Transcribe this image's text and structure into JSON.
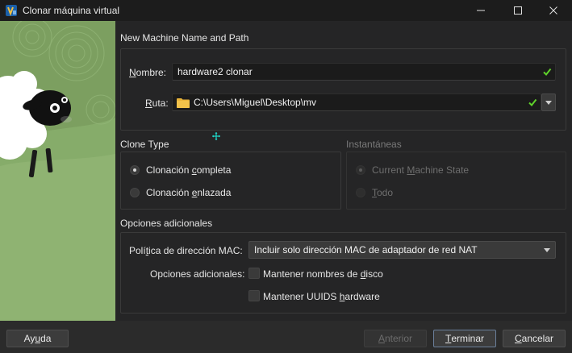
{
  "window": {
    "title": "Clonar máquina virtual",
    "icons": [
      "virtualbox-logo-icon",
      "minimize-icon",
      "maximize-icon",
      "close-icon"
    ]
  },
  "name_path": {
    "header": "New Machine Name and Path",
    "name_label_mnemonic": "N",
    "name_label_rest": "ombre:",
    "name_value": "hardware2 clonar",
    "path_label_mnemonic": "R",
    "path_label_rest": "uta:",
    "path_value": "C:\\Users\\Miguel\\Desktop\\mv"
  },
  "clone_type": {
    "header": "Clone Type",
    "full_pre": "Clonación ",
    "full_mnemonic": "c",
    "full_post": "ompleta",
    "linked_pre": "Clonación ",
    "linked_mnemonic": "e",
    "linked_post": "nlazada",
    "selected": "full"
  },
  "snapshots": {
    "header": "Instantáneas",
    "current_pre": "Current ",
    "current_mnemonic": "M",
    "current_post": "achine State",
    "all_mnemonic": "T",
    "all_post": "odo"
  },
  "additional": {
    "header": "Opciones adicionales",
    "mac_label_pre": "Polí",
    "mac_label_mnemonic": "t",
    "mac_label_post": "ica de dirección MAC:",
    "mac_value": "Incluir solo dirección MAC de adaptador de red NAT",
    "options_label": "Opciones adicionales:",
    "keep_disk_pre": "Mantener nombres de ",
    "keep_disk_mnemonic": "d",
    "keep_disk_post": "isco",
    "keep_uuid_pre": "Mantener UUIDS ",
    "keep_uuid_mnemonic": "h",
    "keep_uuid_post": "ardware"
  },
  "footer": {
    "help_pre": "Ay",
    "help_mnemonic": "u",
    "help_post": "da",
    "back_mnemonic": "A",
    "back_post": "nterior",
    "finish_mnemonic": "T",
    "finish_post": "erminar",
    "cancel_mnemonic": "C",
    "cancel_post": "ancelar"
  },
  "colors": {
    "accent_ok": "#5fd12a",
    "folder": "#e8b339",
    "illustration_green": "#86ac6a"
  }
}
